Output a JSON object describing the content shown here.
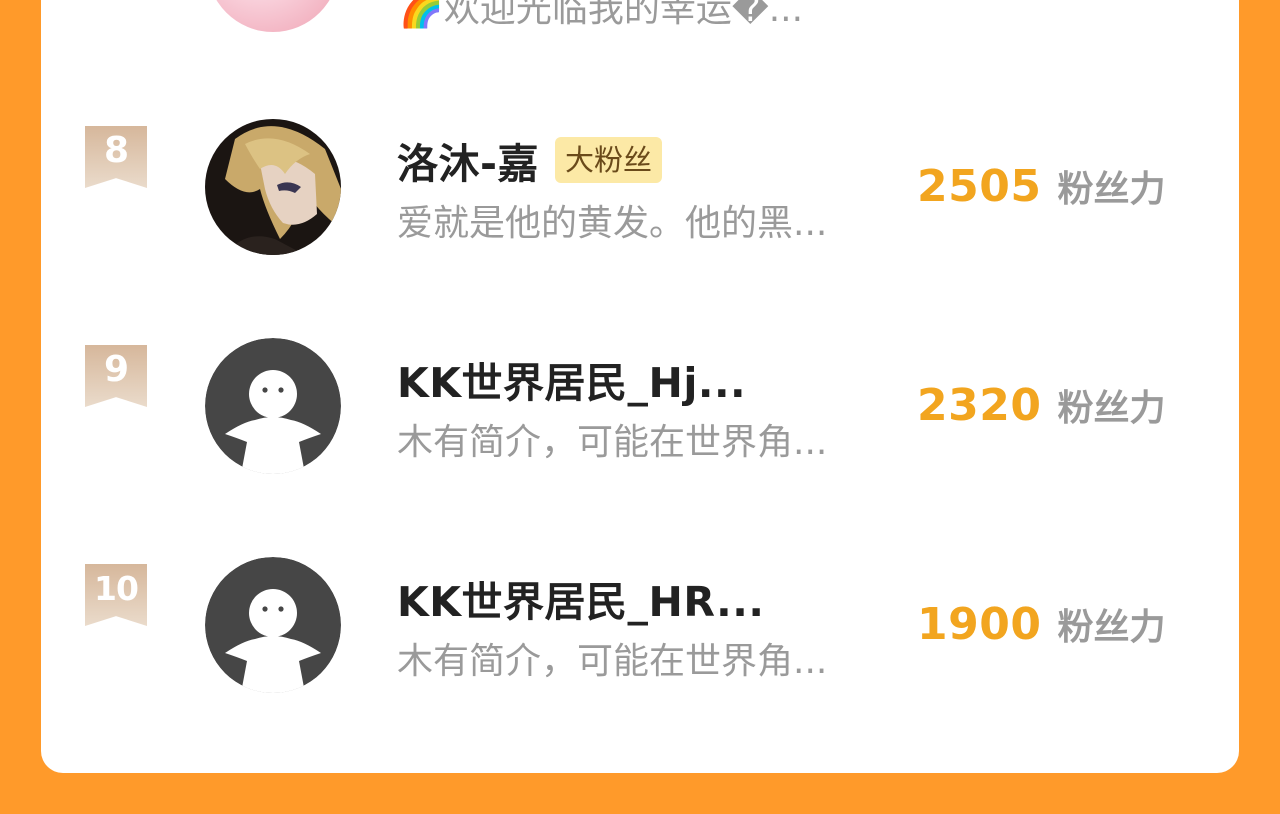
{
  "previous_row": {
    "bio": "🌈欢迎光临我的幸运�..."
  },
  "rows": [
    {
      "rank": "8",
      "name": "洛沐-嘉",
      "badge": "大粉丝",
      "bio": "爱就是他的黄发。他的黑...",
      "score": "2505",
      "score_unit": "粉丝力"
    },
    {
      "rank": "9",
      "name": "KK世界居民_Hj...",
      "bio": "木有简介，可能在世界角...",
      "score": "2320",
      "score_unit": "粉丝力"
    },
    {
      "rank": "10",
      "name": "KK世界居民_HR...",
      "bio": "木有简介，可能在世界角...",
      "score": "1900",
      "score_unit": "粉丝力"
    }
  ],
  "colors": {
    "page_background": "#ff9a2a",
    "score": "#f2a51f",
    "badge_background": "#fce9a6",
    "rank_ribbon": "#d6b79b"
  },
  "icons": {
    "rank_badge": "rank-ribbon-icon",
    "default_avatar": "default-avatar-icon"
  }
}
